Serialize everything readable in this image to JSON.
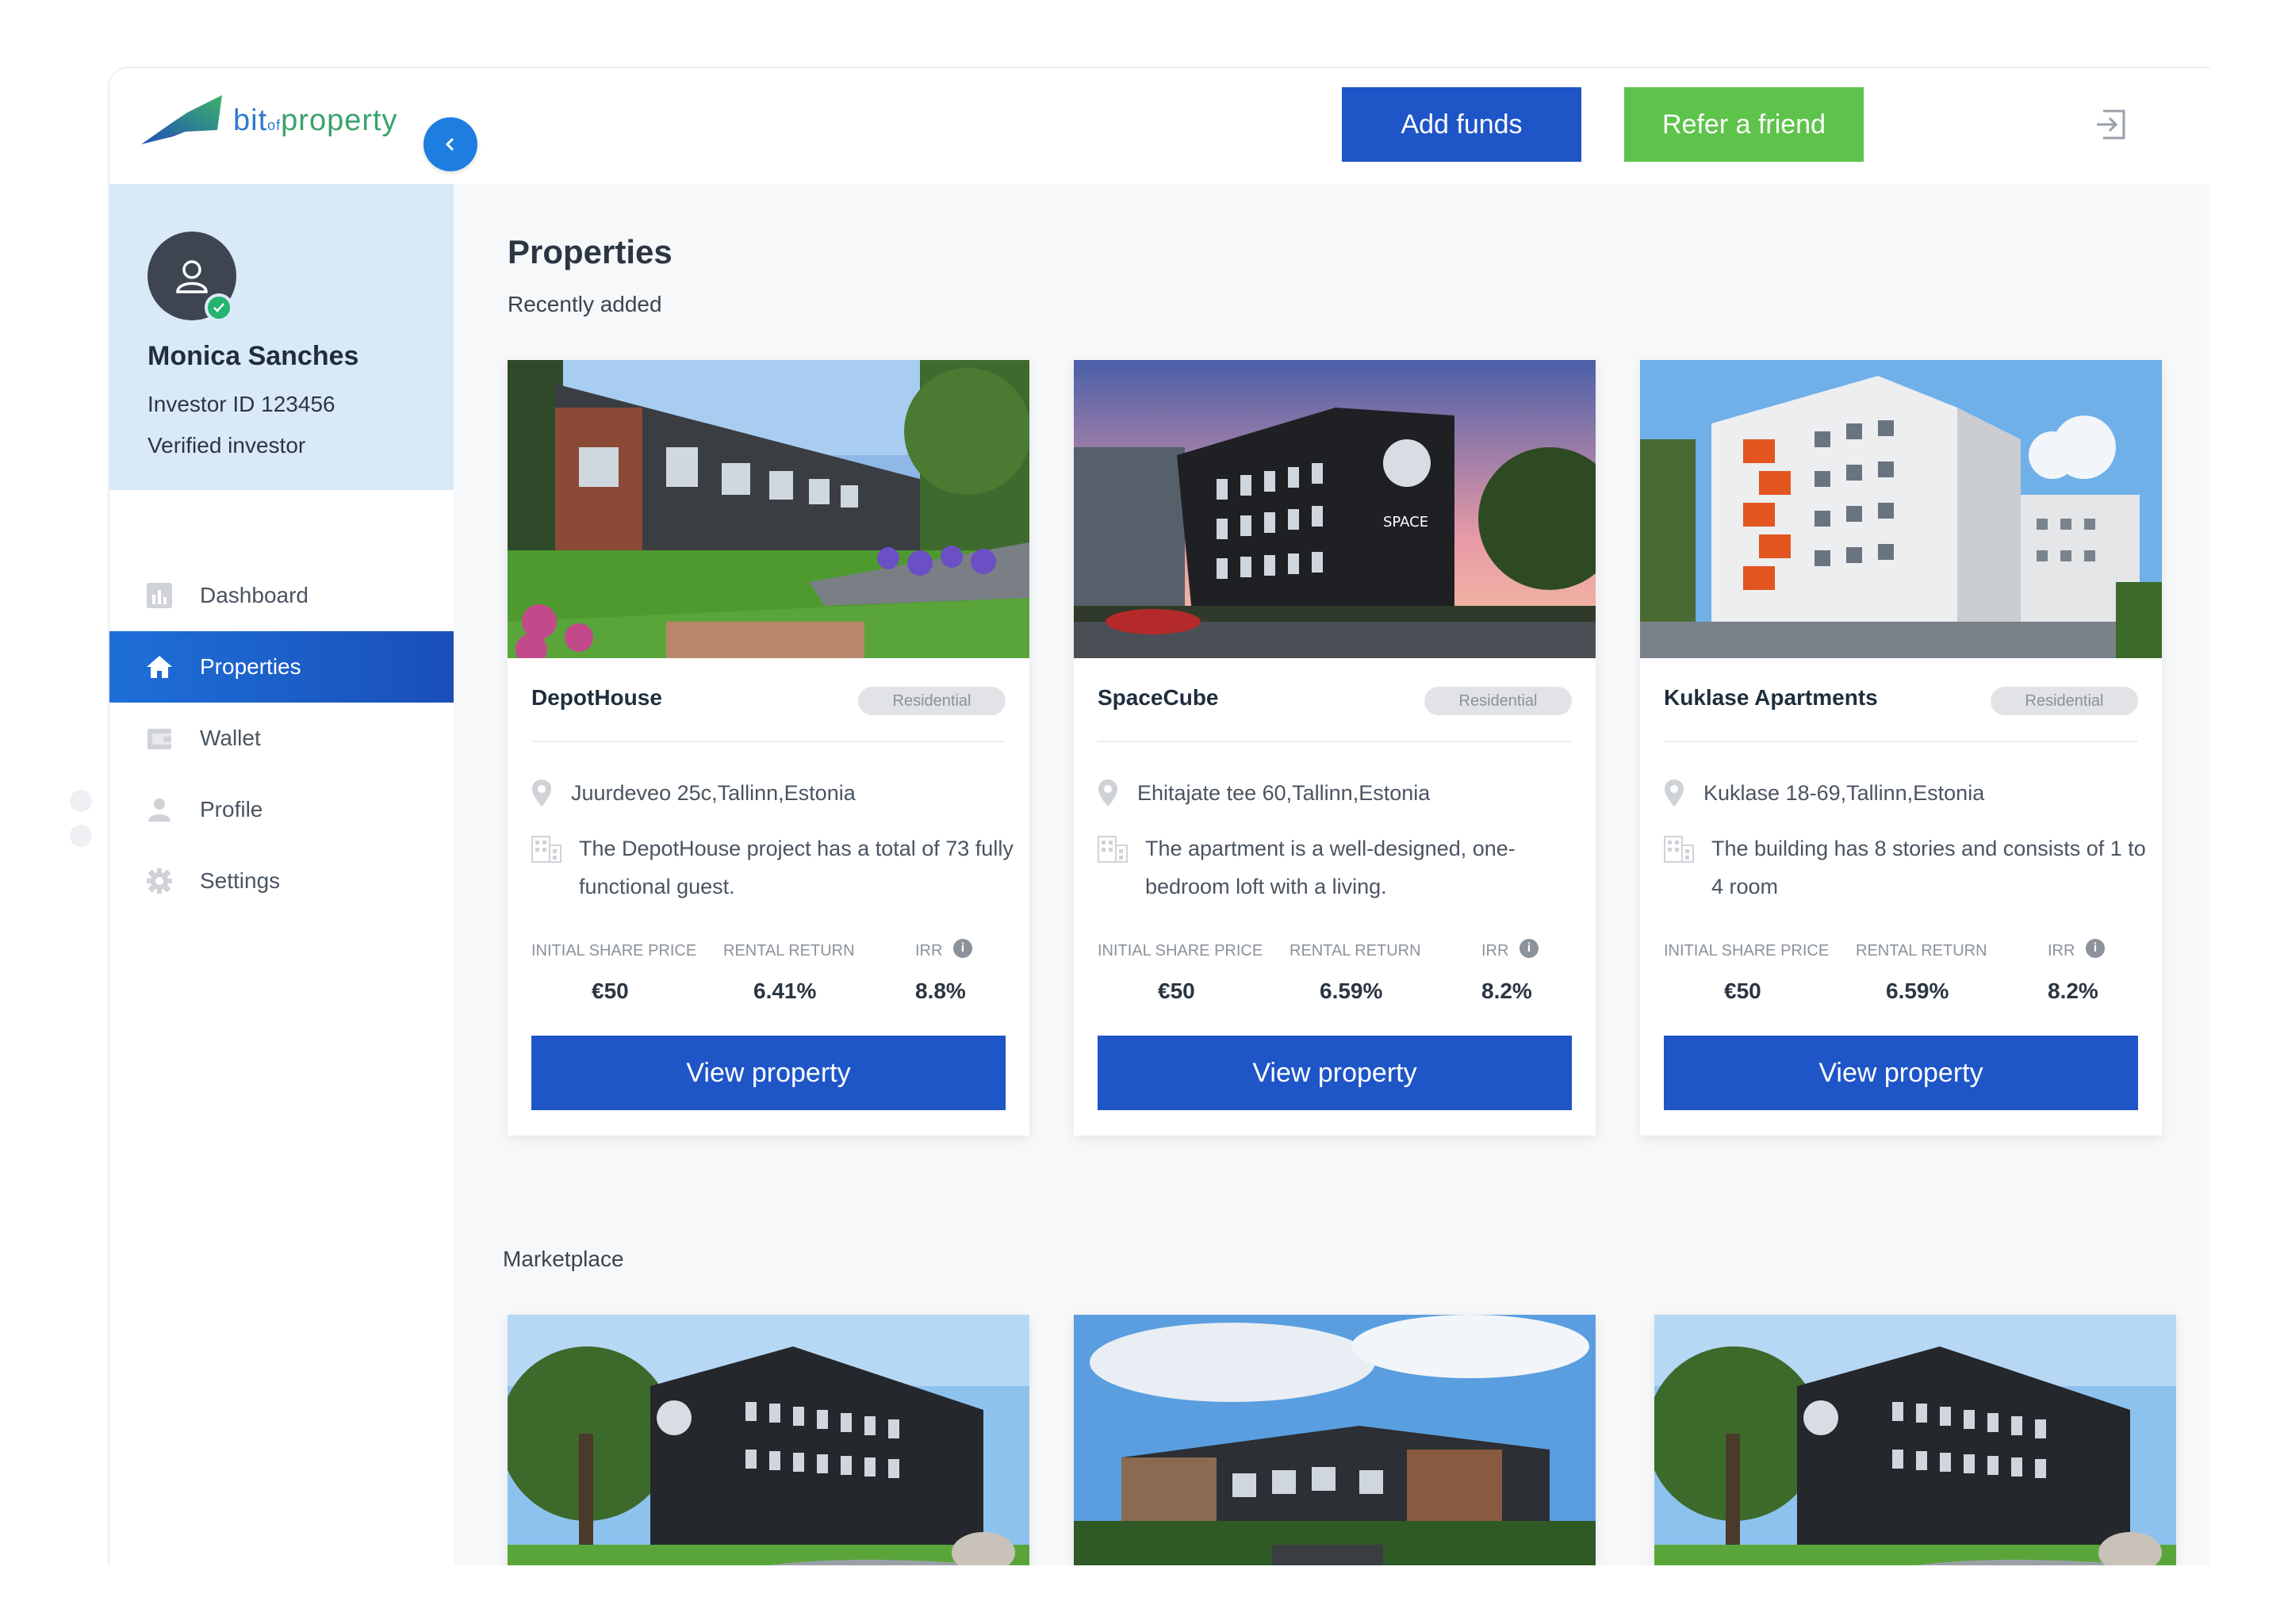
{
  "header": {
    "logo_text_1": "bit",
    "logo_text_of": "of",
    "logo_text_2": "property",
    "add_funds": "Add funds",
    "refer_friend": "Refer a friend",
    "logout_icon": "logout-icon"
  },
  "user": {
    "name": "Monica Sanches",
    "investor_id": "Investor ID  123456",
    "status": "Verified investor"
  },
  "nav": {
    "items": [
      {
        "label": "Dashboard",
        "icon": "bar-chart-icon",
        "active": false
      },
      {
        "label": "Properties",
        "icon": "home-icon",
        "active": true
      },
      {
        "label": "Wallet",
        "icon": "wallet-icon",
        "active": false
      },
      {
        "label": "Profile",
        "icon": "person-icon",
        "active": false
      },
      {
        "label": "Settings",
        "icon": "gear-icon",
        "active": false
      }
    ]
  },
  "main": {
    "title": "Properties",
    "recent_label": "Recently added",
    "marketplace_label": "Marketplace",
    "stat_labels": {
      "price": "INITIAL SHARE PRICE",
      "rental": "RENTAL RETURN",
      "irr": "IRR"
    },
    "view_label": "View property",
    "cards": [
      {
        "name": "DepotHouse",
        "badge": "Residential",
        "address": "Juurdeveo 25c,Tallinn,Estonia",
        "description": "The DepotHouse project has a total of 73 fully functional guest.",
        "price": "€50",
        "rental": "6.41%",
        "irr": "8.8%"
      },
      {
        "name": "SpaceCube",
        "badge": "Residential",
        "address": "Ehitajate tee 60,Tallinn,Estonia",
        "description": "The apartment is a well-designed, one-bedroom loft with a living.",
        "price": "€50",
        "rental": "6.59%",
        "irr": "8.2%"
      },
      {
        "name": "Kuklase Apartments",
        "badge": "Residential",
        "address": "Kuklase 18-69,Tallinn,Estonia",
        "description": "The building has 8 stories and consists of 1 to 4 room",
        "price": "€50",
        "rental": "6.59%",
        "irr": "8.2%"
      }
    ]
  },
  "colors": {
    "primary": "#1e55c7",
    "accent_green": "#5ec34a",
    "sidebar_profile_bg": "#d9e9f8",
    "badge_bg": "#e1e3e6"
  }
}
